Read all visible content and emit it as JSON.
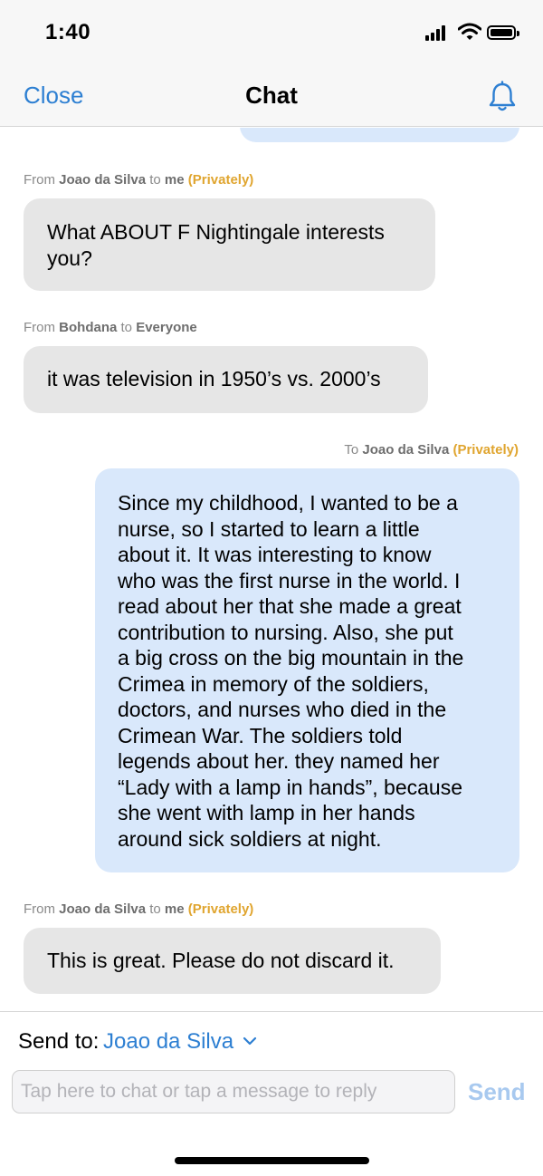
{
  "status_bar": {
    "time": "1:40"
  },
  "nav": {
    "close_label": "Close",
    "title": "Chat",
    "bell_icon": "bell-icon"
  },
  "messages": [
    {
      "direction": "out",
      "partial": true
    },
    {
      "direction": "in",
      "from_prefix": "From",
      "sender": "Joao da Silva",
      "to_word": "to",
      "recipient": "me",
      "privacy": "(Privately)",
      "lines": [
        "What ABOUT F Nightingale interests",
        "you?"
      ]
    },
    {
      "direction": "in",
      "from_prefix": "From",
      "sender": "Bohdana",
      "to_word": "to",
      "recipient": "Everyone",
      "lines": [
        "it was television in 1950’s vs. 2000’s"
      ]
    },
    {
      "direction": "out",
      "to_prefix": "To",
      "recipient": "Joao da Silva",
      "privacy": "(Privately)",
      "lines": [
        "Since my childhood, I wanted to be a",
        "nurse, so I started to learn a little",
        "about it. It was interesting to know",
        "who was the first nurse in the world. I",
        "read about her that she made a great",
        "contribution to nursing. Also, she put",
        "a big cross on the big mountain in the",
        "Crimea in memory of the soldiers,",
        "doctors, and nurses who died in the",
        "Crimean War. The soldiers told",
        "legends about her. they named her",
        "“Lady with a lamp in hands”, because",
        "she went with lamp in her hands",
        "around sick soldiers at night."
      ]
    },
    {
      "direction": "in",
      "from_prefix": "From",
      "sender": "Joao da Silva",
      "to_word": "to",
      "recipient": "me",
      "privacy": "(Privately)",
      "lines": [
        "This is great. Please do not discard it."
      ]
    }
  ],
  "compose": {
    "send_to_label": "Send to:",
    "send_to_value": "Joao da Silva",
    "input_placeholder": "Tap here to chat or tap a message to reply",
    "input_value": "",
    "send_label": "Send"
  },
  "colors": {
    "accent": "#2d7fd2",
    "private": "#e0a52f",
    "incoming_bubble": "#e6e6e6",
    "outgoing_bubble": "#d9e8fb",
    "send_disabled": "#a8c9ef"
  }
}
